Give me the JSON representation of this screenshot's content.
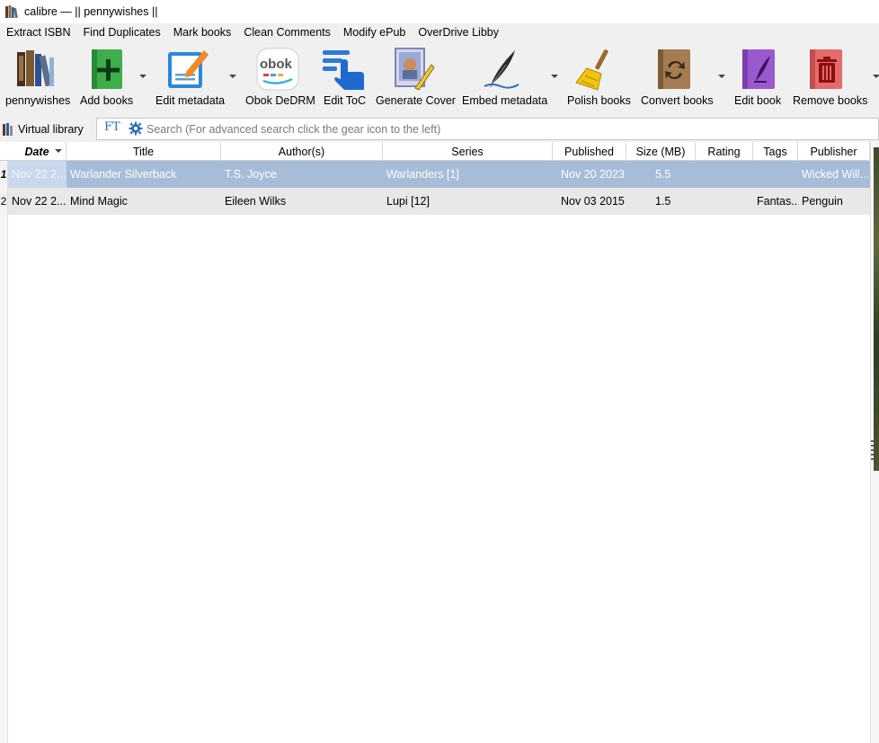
{
  "window": {
    "title": "calibre — || pennywishes ||"
  },
  "menu": [
    "Extract ISBN",
    "Find Duplicates",
    "Mark books",
    "Clean Comments",
    "Modify ePub",
    "OverDrive Libby"
  ],
  "toolbar": {
    "library": "pennywishes",
    "add": "Add books",
    "edit_metadata": "Edit metadata",
    "obok": "Obok DeDRM",
    "obok_icon_text": "obok",
    "edit_toc": "Edit ToC",
    "generate_cover": "Generate Cover",
    "embed_metadata": "Embed metadata",
    "polish": "Polish books",
    "convert": "Convert books",
    "edit_book": "Edit book",
    "remove": "Remove books"
  },
  "search": {
    "virtual_library": "Virtual library",
    "ft_label": "FT",
    "placeholder": "Search (For advanced search click the gear icon to the left)"
  },
  "columns": {
    "date": "Date",
    "title": "Title",
    "authors": "Author(s)",
    "series": "Series",
    "published": "Published",
    "size": "Size (MB)",
    "rating": "Rating",
    "tags": "Tags",
    "publisher": "Publisher"
  },
  "books": [
    {
      "num": "1",
      "date": "Nov 22 2...",
      "title": "Warlander Silverback",
      "authors": "T.S. Joyce",
      "series": "Warlanders [1]",
      "published": "Nov 20 2023",
      "size": "5.5",
      "rating": "",
      "tags": "",
      "publisher": "Wicked Will..."
    },
    {
      "num": "2",
      "date": "Nov 22 2...",
      "title": "Mind Magic",
      "authors": "Eileen Wilks",
      "series": "Lupi [12]",
      "published": "Nov 03 2015",
      "size": "1.5",
      "rating": "",
      "tags": "Fantas...",
      "publisher": "Penguin"
    }
  ]
}
